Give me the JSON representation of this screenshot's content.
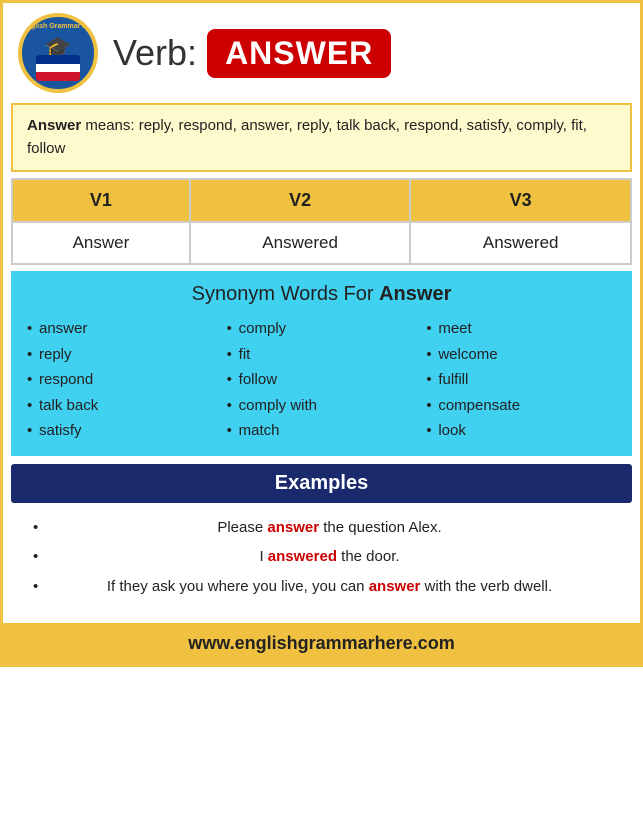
{
  "header": {
    "verb_label": "Verb:",
    "answer_badge": "ANSWER",
    "logo_alt": "English Grammar Here Logo"
  },
  "means": {
    "word": "Answer",
    "text": " means: reply, respond, answer, reply, talk back, respond, satisfy, comply, fit, follow"
  },
  "forms": {
    "headers": [
      "V1",
      "V2",
      "V3"
    ],
    "rows": [
      [
        "Answer",
        "Answered",
        "Answered"
      ]
    ]
  },
  "synonyms": {
    "title": "Synonym Words For ",
    "title_bold": "Answer",
    "columns": [
      [
        "answer",
        "reply",
        "respond",
        "talk back",
        "satisfy"
      ],
      [
        "comply",
        "fit",
        "follow",
        "comply with",
        "match"
      ],
      [
        "meet",
        "welcome",
        "fulfill",
        "compensate",
        "look"
      ]
    ]
  },
  "examples": {
    "header": "Examples",
    "items": [
      {
        "pre": "Please ",
        "highlight": "answer",
        "post": " the question Alex.",
        "center": true
      },
      {
        "pre": "I ",
        "highlight": "answered",
        "post": " the door.",
        "center": true
      },
      {
        "pre": "If they ask you where you live, you can ",
        "highlight": "answer",
        "post": " with the verb dwell.",
        "center": true
      }
    ]
  },
  "footer": {
    "url": "www.englishgrammarhere.com"
  }
}
